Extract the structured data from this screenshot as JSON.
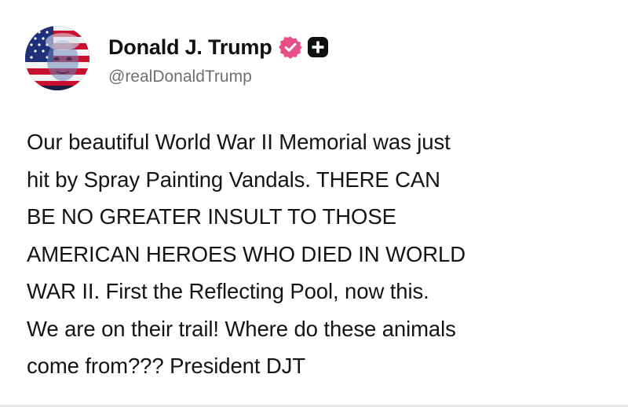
{
  "post": {
    "author": {
      "display_name": "Donald J. Trump",
      "handle": "@realDonaldTrump",
      "avatar_icon": "flag-portrait-avatar",
      "verified_icon": "verified-badge-icon",
      "plus_icon": "plus-badge-icon"
    },
    "body_lines": [
      "Our beautiful World War II Memorial was just",
      "hit by Spray Painting Vandals. THERE CAN",
      "BE NO GREATER INSULT TO THOSE",
      "AMERICAN HEROES WHO DIED IN WORLD",
      "WAR II. First the Reflecting Pool, now this.",
      "We are on their trail! Where do these animals",
      "come from??? President DJT"
    ]
  },
  "colors": {
    "verified": "#e84f86",
    "plus_badge": "#101010",
    "handle_text": "#6f6f6f"
  }
}
